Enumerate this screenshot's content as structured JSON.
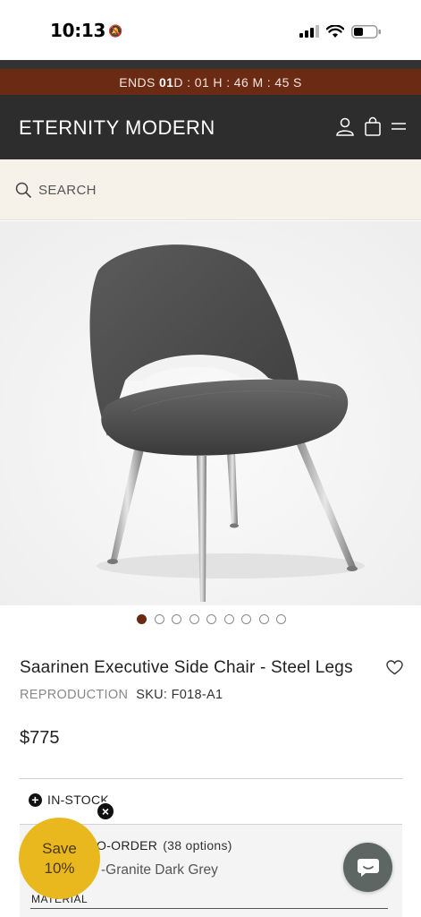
{
  "status_bar": {
    "time": "10:13"
  },
  "countdown": {
    "prefix": "ENDS",
    "days_value": "01",
    "rest": " D : 01 H : 46 M : 45 S"
  },
  "header": {
    "brand": "ETERNITY MODERN"
  },
  "search": {
    "label": "SEARCH"
  },
  "gallery": {
    "total_images": 9,
    "active_index": 0
  },
  "product": {
    "title": "Saarinen Executive Side Chair - Steel Legs",
    "category": "REPRODUCTION",
    "sku": "SKU: F018-A1",
    "price": "$775",
    "stock_status": "IN-STOCK",
    "order_label": "O-ORDER",
    "options_count": "(38 options)",
    "fabric_partial": "-Granite Dark Grey",
    "material_label": "MATERIAL"
  },
  "promo": {
    "line1": "Save",
    "line2": "10%"
  },
  "colors": {
    "countdown_bg": "#6b2a14",
    "header_bg": "#2d2d2d",
    "search_bg": "#f6f2ea",
    "promo_badge": "#e9b81f",
    "chat_button": "#5e6663"
  }
}
